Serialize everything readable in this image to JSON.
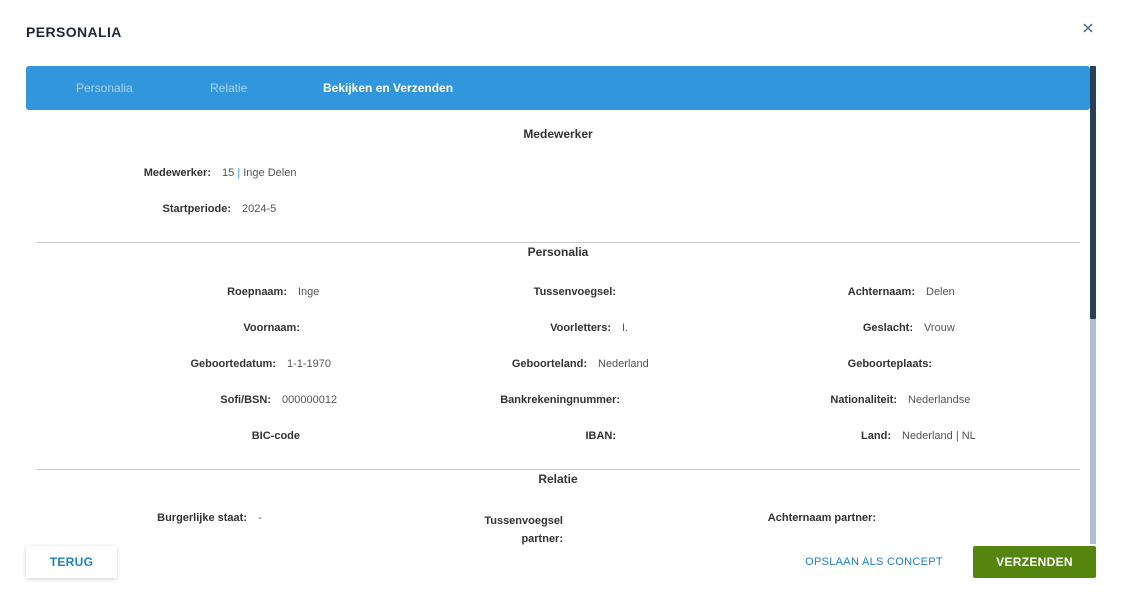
{
  "modal": {
    "title": "PERSONALIA",
    "close_icon": "close-icon"
  },
  "stepper": {
    "steps": [
      {
        "label": "Personalia",
        "state": "inactive"
      },
      {
        "label": "Relatie",
        "state": "inactive"
      },
      {
        "label": "Bekijken en Verzenden",
        "state": "active"
      }
    ],
    "color": "#3296dc"
  },
  "sections": {
    "medewerker": {
      "title": "Medewerker",
      "medewerker_label": "Medewerker:",
      "medewerker_id": "15",
      "separator": "|",
      "medewerker_name": "Inge Delen",
      "startperiode_label": "Startperiode:",
      "startperiode_value": "2024-5"
    },
    "personalia": {
      "title": "Personalia",
      "fields": [
        {
          "label": "Roepnaam:",
          "value": "Inge"
        },
        {
          "label": "Tussenvoegsel:",
          "value": ""
        },
        {
          "label": "Achternaam:",
          "value": "Delen"
        },
        {
          "label": "Voornaam:",
          "value": ""
        },
        {
          "label": "Voorletters:",
          "value": "I."
        },
        {
          "label": "Geslacht:",
          "value": "Vrouw"
        },
        {
          "label": "Geboortedatum:",
          "value": "1-1-1970"
        },
        {
          "label": "Geboorteland:",
          "value": "Nederland"
        },
        {
          "label": "Geboorteplaats:",
          "value": ""
        },
        {
          "label": "Sofi/BSN:",
          "value": "000000012"
        },
        {
          "label": "Bankrekeningnummer:",
          "value": ""
        },
        {
          "label": "Nationaliteit:",
          "value": "Nederlandse"
        },
        {
          "label": "BIC-code",
          "value": ""
        },
        {
          "label": "IBAN:",
          "value": ""
        },
        {
          "label": "Land:",
          "value": "Nederland | NL"
        }
      ]
    },
    "relatie": {
      "title": "Relatie",
      "burgerlijke_staat_label": "Burgerlijke staat:",
      "burgerlijke_staat_value": "-",
      "tussenvoegsel_partner_line1": "Tussenvoegsel",
      "tussenvoegsel_partner_line2": "partner:",
      "achternaam_partner_label": "Achternaam partner:"
    }
  },
  "footer": {
    "back_label": "TERUG",
    "draft_label": "OPSLAAN ALS CONCEPT",
    "send_label": "VERZENDEN",
    "send_color": "#53850f"
  }
}
